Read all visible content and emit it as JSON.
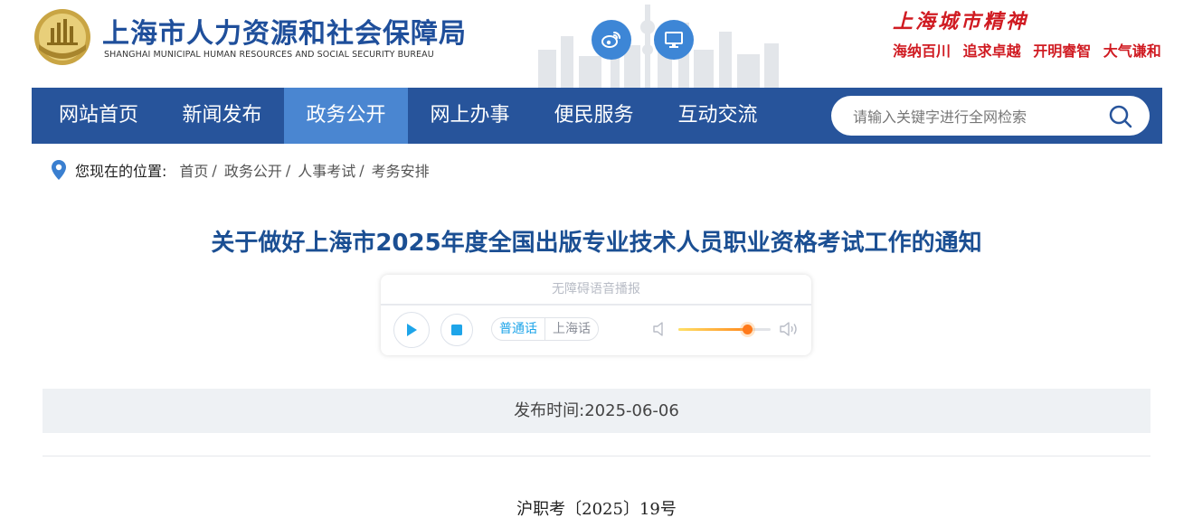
{
  "header": {
    "site_title": "上海市人力资源和社会保障局",
    "site_subtitle": "SHANGHAI MUNICIPAL HUMAN RESOURCES AND SOCIAL SECURITY BUREAU",
    "weibo_icon": "weibo-icon",
    "pc_icon": "monitor-icon",
    "spirit_title": "上海城市精神",
    "spirit_words": [
      "海纳百川",
      "追求卓越",
      "开明睿智",
      "大气谦和"
    ],
    "brand_color": "#1f4f9b",
    "spirit_color": "#d01b22"
  },
  "nav": {
    "items": [
      {
        "label": "网站首页"
      },
      {
        "label": "新闻发布"
      },
      {
        "label": "政务公开"
      },
      {
        "label": "网上办事"
      },
      {
        "label": "便民服务"
      },
      {
        "label": "互动交流"
      }
    ],
    "active_index": 2,
    "search_placeholder": "请输入关键字进行全网检索",
    "bar_color": "#27549b",
    "active_color": "#4a86d1"
  },
  "breadcrumb": {
    "label": "您现在的位置:",
    "items": [
      "首页",
      "政务公开",
      "人事考试",
      "考务安排"
    ],
    "separator": "/"
  },
  "article": {
    "title": "关于做好上海市2025年度全国出版专业技术人员职业资格考试工作的通知",
    "publish_time": "发布时间:2025-06-06",
    "doc_number": "沪职考〔2025〕19号"
  },
  "player": {
    "header": "无障碍语音播报",
    "dialect_options": [
      "普通话",
      "上海话"
    ],
    "selected_dialect": "普通话",
    "volume": 0.75
  }
}
